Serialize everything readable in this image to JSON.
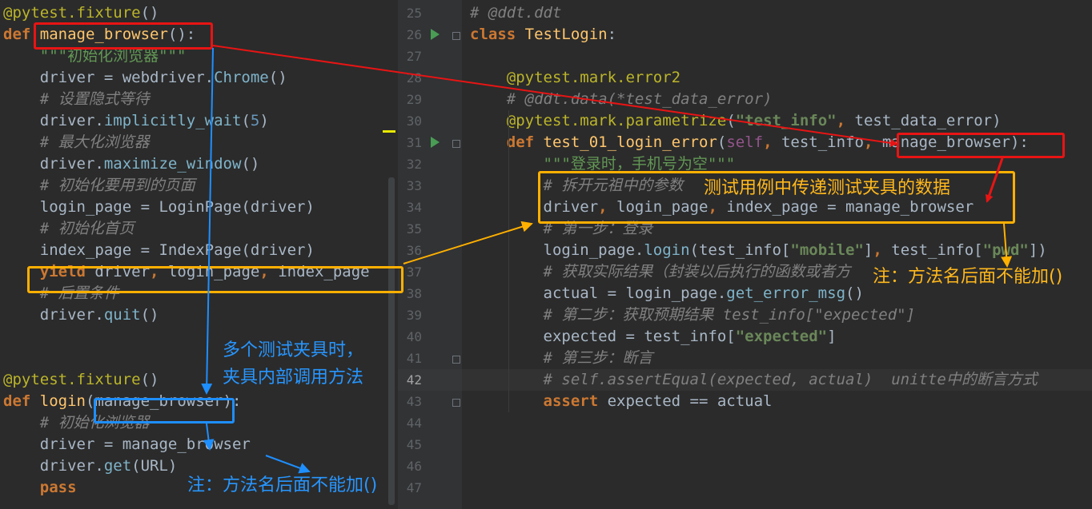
{
  "left_code": [
    [
      [
        "deco",
        "@pytest.fixture"
      ],
      [
        "p",
        "()"
      ]
    ],
    [
      [
        "kw",
        "def "
      ],
      [
        "fn",
        "manage_browser"
      ],
      [
        "p",
        "():"
      ]
    ],
    [
      [
        "p",
        "    "
      ],
      [
        "doc",
        "\"\"\"初始化浏览器\"\"\""
      ]
    ],
    [
      [
        "p",
        "    driver = webdriver."
      ],
      [
        "meth",
        "Chrome"
      ],
      [
        "p",
        "()"
      ]
    ],
    [
      [
        "p",
        "    "
      ],
      [
        "cmt",
        "# 设置隐式等待"
      ]
    ],
    [
      [
        "p",
        "    driver."
      ],
      [
        "meth",
        "implicitly_wait"
      ],
      [
        "p",
        "("
      ],
      [
        "num",
        "5"
      ],
      [
        "p",
        ")"
      ]
    ],
    [
      [
        "p",
        "    "
      ],
      [
        "cmt",
        "# 最大化浏览器"
      ]
    ],
    [
      [
        "p",
        "    driver."
      ],
      [
        "meth",
        "maximize_window"
      ],
      [
        "p",
        "()"
      ]
    ],
    [
      [
        "p",
        "    "
      ],
      [
        "cmt",
        "# 初始化要用到的页面"
      ]
    ],
    [
      [
        "p",
        "    login_page = LoginPage(driver)"
      ]
    ],
    [
      [
        "p",
        "    "
      ],
      [
        "cmt",
        "# 初始化首页"
      ]
    ],
    [
      [
        "p",
        "    index_page = IndexPage(driver)"
      ]
    ],
    [
      [
        "p",
        "    "
      ],
      [
        "kw",
        "yield"
      ],
      [
        "p",
        " driver"
      ],
      [
        "kw",
        ","
      ],
      [
        "p",
        " login_page"
      ],
      [
        "kw",
        ","
      ],
      [
        "p",
        " index_page"
      ]
    ],
    [
      [
        "p",
        "    "
      ],
      [
        "cmt",
        "# 后置条件"
      ]
    ],
    [
      [
        "p",
        "    driver."
      ],
      [
        "meth",
        "quit"
      ],
      [
        "p",
        "()"
      ]
    ],
    [
      [
        "p",
        ""
      ]
    ],
    [
      [
        "p",
        ""
      ]
    ],
    [
      [
        "deco",
        "@pytest.fixture"
      ],
      [
        "p",
        "()"
      ]
    ],
    [
      [
        "kw",
        "def "
      ],
      [
        "fn",
        "login"
      ],
      [
        "p",
        "(manage_browser):"
      ]
    ],
    [
      [
        "p",
        "    "
      ],
      [
        "cmt",
        "# 初始化浏览器"
      ]
    ],
    [
      [
        "p",
        "    driver = manage_browser"
      ]
    ],
    [
      [
        "p",
        "    driver."
      ],
      [
        "meth",
        "get"
      ],
      [
        "p",
        "(URL)"
      ]
    ],
    [
      [
        "p",
        "    "
      ],
      [
        "kw",
        "pass"
      ]
    ]
  ],
  "right_code": [
    {
      "n": "25",
      "segs": [
        [
          "cmt",
          "# @ddt.ddt"
        ]
      ]
    },
    {
      "n": "26",
      "segs": [
        [
          "kw",
          "class "
        ],
        [
          "cls",
          "TestLogin"
        ],
        [
          "p",
          ":"
        ]
      ]
    },
    {
      "n": "27",
      "segs": [
        [
          "p",
          ""
        ]
      ]
    },
    {
      "n": "28",
      "segs": [
        [
          "p",
          "    "
        ],
        [
          "deco",
          "@pytest.mark.error2"
        ]
      ]
    },
    {
      "n": "29",
      "segs": [
        [
          "p",
          "    "
        ],
        [
          "cmt",
          "# @ddt.data(*test_data_error)"
        ]
      ]
    },
    {
      "n": "30",
      "segs": [
        [
          "p",
          "    "
        ],
        [
          "deco",
          "@pytest.mark.parametrize"
        ],
        [
          "p",
          "("
        ],
        [
          "str",
          "\"test_info\""
        ],
        [
          "kw",
          ","
        ],
        [
          "p",
          " test_data_error)"
        ]
      ]
    },
    {
      "n": "31",
      "segs": [
        [
          "p",
          "    "
        ],
        [
          "kw",
          "def "
        ],
        [
          "fn",
          "test_01_login_error"
        ],
        [
          "p",
          "("
        ],
        [
          "self",
          "self"
        ],
        [
          "kw",
          ","
        ],
        [
          "p",
          " test_info"
        ],
        [
          "kw",
          ","
        ],
        [
          "p",
          " manage_browser):"
        ]
      ]
    },
    {
      "n": "32",
      "segs": [
        [
          "p",
          "        "
        ],
        [
          "doc",
          "\"\"\"登录时，手机号为空\"\"\""
        ]
      ]
    },
    {
      "n": "33",
      "segs": [
        [
          "p",
          "        "
        ],
        [
          "cmt",
          "# 拆开元祖中的参数"
        ]
      ]
    },
    {
      "n": "34",
      "segs": [
        [
          "p",
          "        driver"
        ],
        [
          "kw",
          ","
        ],
        [
          "p",
          " login_page"
        ],
        [
          "kw",
          ","
        ],
        [
          "p",
          " index_page = manage_browser"
        ]
      ]
    },
    {
      "n": "35",
      "segs": [
        [
          "p",
          "        "
        ],
        [
          "cmt",
          "# 第一步：登录"
        ]
      ]
    },
    {
      "n": "36",
      "segs": [
        [
          "p",
          "        login_page."
        ],
        [
          "meth",
          "login"
        ],
        [
          "p",
          "(test_info["
        ],
        [
          "str",
          "\"mobile\""
        ],
        [
          "p",
          "]"
        ],
        [
          "kw",
          ","
        ],
        [
          "p",
          " test_info["
        ],
        [
          "str",
          "\"pwd\""
        ],
        [
          "p",
          "])"
        ]
      ]
    },
    {
      "n": "37",
      "segs": [
        [
          "p",
          "        "
        ],
        [
          "cmt",
          "# 获取实际结果（封装以后执行的函数或者方"
        ]
      ]
    },
    {
      "n": "38",
      "segs": [
        [
          "p",
          "        actual = login_page."
        ],
        [
          "meth",
          "get_error_msg"
        ],
        [
          "p",
          "()"
        ]
      ]
    },
    {
      "n": "39",
      "segs": [
        [
          "p",
          "        "
        ],
        [
          "cmt",
          "# 第二步：获取预期结果 test_info[\"expected\"]"
        ]
      ]
    },
    {
      "n": "40",
      "segs": [
        [
          "p",
          "        expected = test_info["
        ],
        [
          "str",
          "\"expected\""
        ],
        [
          "p",
          "]"
        ]
      ]
    },
    {
      "n": "41",
      "segs": [
        [
          "p",
          "        "
        ],
        [
          "cmt",
          "# 第三步：断言"
        ]
      ]
    },
    {
      "n": "42",
      "segs": [
        [
          "p",
          "        "
        ],
        [
          "cmt",
          "# self.assertEqual(expected, actual)  unitte中的断言方式"
        ]
      ]
    },
    {
      "n": "43",
      "segs": [
        [
          "p",
          "        "
        ],
        [
          "kw",
          "assert"
        ],
        [
          "p",
          " expected == actual"
        ]
      ]
    },
    {
      "n": "44",
      "segs": [
        [
          "p",
          ""
        ]
      ]
    },
    {
      "n": "45",
      "segs": [
        [
          "p",
          ""
        ]
      ]
    },
    {
      "n": "46",
      "segs": [
        [
          "p",
          ""
        ]
      ]
    },
    {
      "n": "47",
      "segs": [
        [
          "p",
          ""
        ]
      ]
    }
  ],
  "current_line": "42",
  "run_icon_lines": [
    "26",
    "31"
  ],
  "fold_icon_lines": [
    "26",
    "31",
    "41",
    "43"
  ],
  "annotations": {
    "fixture_data_note": "测试用例中传递测试夹具的数据",
    "no_parens_note_right": "注：方法名后面不能加()",
    "multi_fixture_note_line1": "多个测试夹具时，",
    "multi_fixture_note_line2": "夹具内部调用方法",
    "no_parens_note_left": "注：方法名后面不能加()"
  },
  "colors": {
    "red_box": "#e81414",
    "orange_box": "#ffb000",
    "blue_box": "#1e8fff",
    "keyword": "#cc7832",
    "decorator": "#bbb529",
    "function": "#ffc66d",
    "string": "#6a8759",
    "comment": "#808080"
  }
}
